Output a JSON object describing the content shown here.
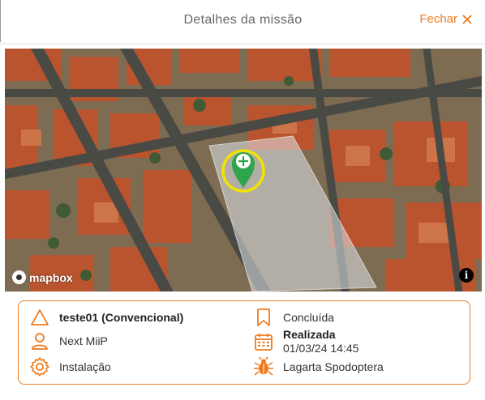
{
  "header": {
    "title": "Detalhes da missão",
    "close_label": "Fechar",
    "accent_color": "#ee7b1d"
  },
  "map": {
    "attribution": "mapbox",
    "info_label": "i",
    "marker_icon": "crosshair-pin-icon"
  },
  "details": {
    "mission_name": "teste01 (Convencional)",
    "client": "Next MiiP",
    "category": "Instalação",
    "status": "Concluída",
    "date_status": "Realizada",
    "date_value": "01/03/24 14:45",
    "pest": "Lagarta Spodoptera",
    "icons": [
      "warning-triangle-icon",
      "user-icon",
      "gear-icon",
      "bookmark-icon",
      "calendar-icon",
      "bug-icon"
    ]
  }
}
